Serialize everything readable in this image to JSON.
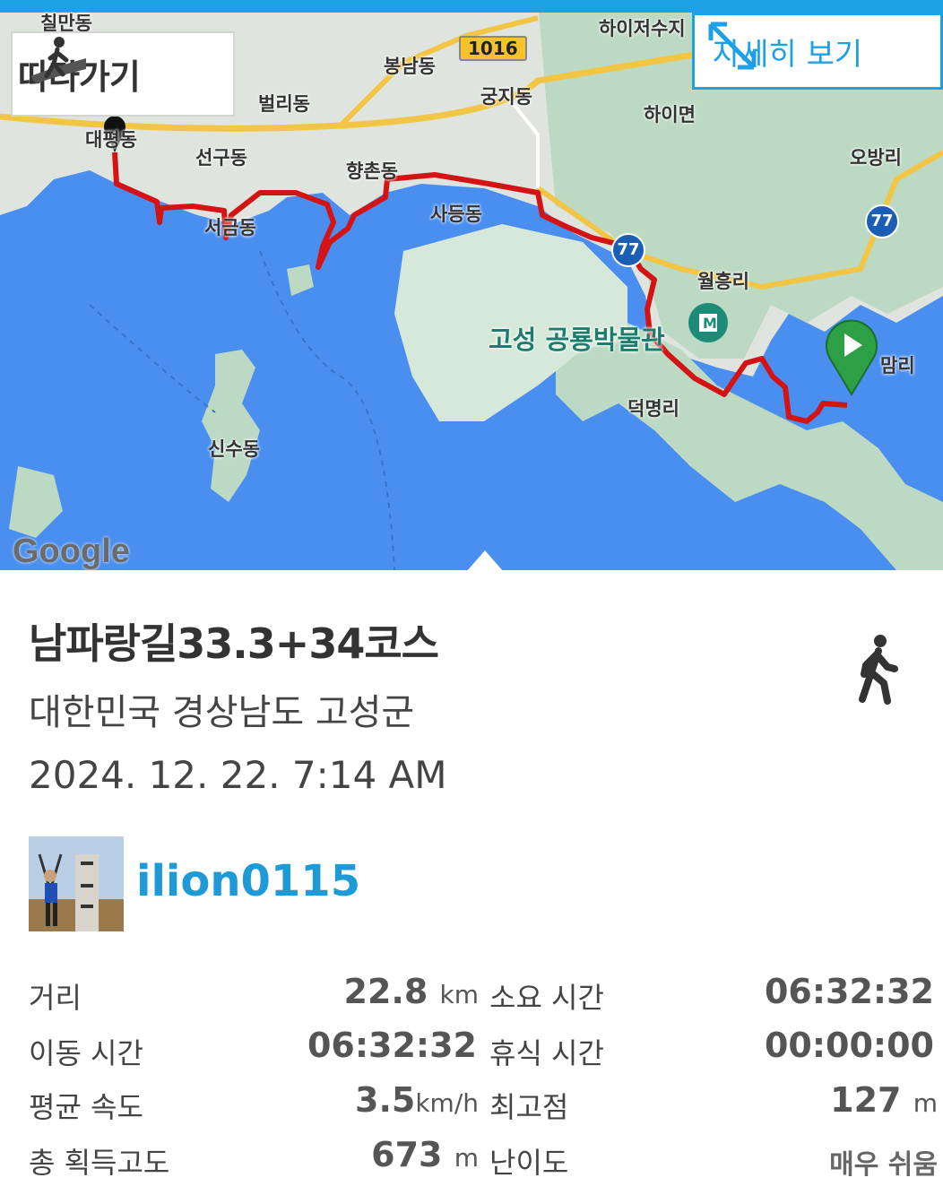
{
  "map": {
    "follow_label": "따라가기",
    "detail_label": "자세히 보기",
    "road_badge": "1016",
    "highway_1": "77",
    "highway_2": "77",
    "museum_label": "고성 공룡박물관",
    "google": "Google",
    "places": [
      "칠만동",
      "봉남동",
      "하이저수지",
      "벌리동",
      "궁지동",
      "하이면",
      "대평동",
      "선구동",
      "향촌동",
      "오방리",
      "사등동",
      "서금동",
      "월흥리",
      "맘리",
      "덕명리",
      "신수동"
    ]
  },
  "trip": {
    "title": "남파랑길33.3+34코스",
    "region": "대한민국 경상남도 고성군",
    "date": "2024. 12. 22. 7:14 AM",
    "user": "ilion0115"
  },
  "stats": {
    "distance_label": "거리",
    "distance": "22.8",
    "distance_unit": "km",
    "duration_label": "소요 시간",
    "duration": "06:32:32",
    "moving_label": "이동 시간",
    "moving": "06:32:32",
    "rest_label": "휴식 시간",
    "rest": "00:00:00",
    "speed_label": "평균 속도",
    "speed": "3.5",
    "speed_unit": "km/h",
    "max_alt_label": "최고점",
    "max_alt": "127",
    "max_alt_unit": "m",
    "gain_label": "총 획득고도",
    "gain": "673",
    "gain_unit": "m",
    "difficulty_label": "난이도",
    "difficulty": "매우 쉬움"
  },
  "colors": {
    "accent": "#1ea0e6",
    "route": "#d41414",
    "water": "#4a8ff0",
    "land": "#dfe6e0"
  }
}
